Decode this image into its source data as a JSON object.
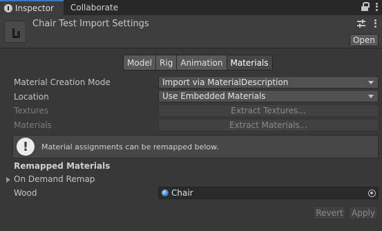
{
  "tabs": {
    "inspector": "Inspector",
    "collaborate": "Collaborate"
  },
  "header": {
    "title": "Chair Test Import Settings",
    "open_label": "Open"
  },
  "import_tabs": [
    "Model",
    "Rig",
    "Animation",
    "Materials"
  ],
  "active_import_tab": "Materials",
  "fields": {
    "material_creation_mode": {
      "label": "Material Creation Mode",
      "value": "Import via MaterialDescription"
    },
    "location": {
      "label": "Location",
      "value": "Use Embedded Materials"
    },
    "textures": {
      "label": "Textures",
      "button": "Extract Textures..."
    },
    "materials": {
      "label": "Materials",
      "button": "Extract Materials..."
    }
  },
  "helpbox": {
    "icon": "warning-icon",
    "symbol": "!",
    "text": "Material assignments can be remapped below."
  },
  "remapped": {
    "title": "Remapped Materials",
    "foldout_label": "On Demand Remap",
    "entries": [
      {
        "label": "Wood",
        "value": "Chair"
      }
    ]
  },
  "footer": {
    "revert_label": "Revert",
    "apply_label": "Apply"
  },
  "colors": {
    "background": "#383838",
    "tab_accent": "#3a79bb",
    "material_icon": "#3d7fc4"
  }
}
